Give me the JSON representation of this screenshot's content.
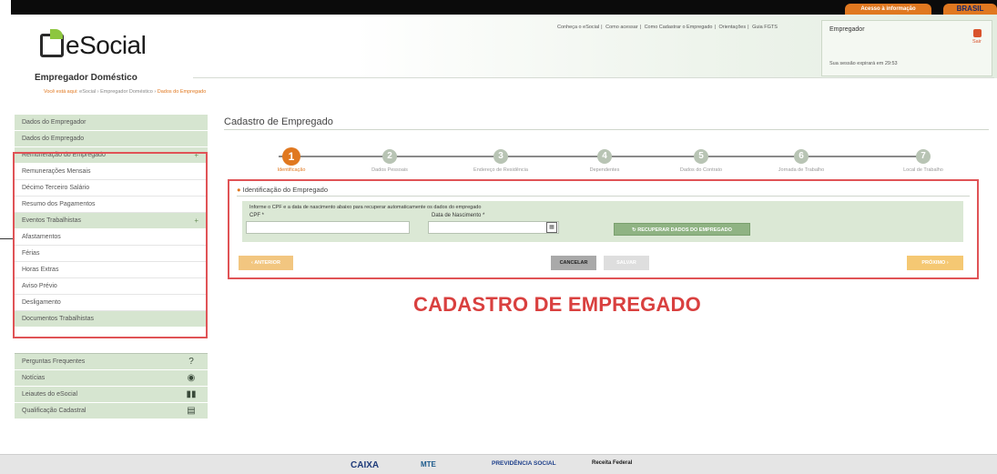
{
  "topbar": {
    "acesso_label": "Acesso à informação",
    "brasil_label": "BRASIL"
  },
  "header": {
    "logo_text": "eSocial",
    "links": [
      "Conheça o eSocial",
      "Como acessar",
      "Como Cadastrar o Empregado",
      "Orientações",
      "Guia FGTS"
    ],
    "user_label": "Empregador",
    "session_text": "Sua sessão expirará em 29:53",
    "exit_label": "Sair"
  },
  "page": {
    "section_title": "Empregador Doméstico",
    "breadcrumb_prefix": "Você está aqui:",
    "breadcrumb_path": "eSocial › Empregador Doméstico ›",
    "breadcrumb_current": "Dados do Empregado"
  },
  "sidebar": {
    "items": [
      {
        "label": "Dados do Empregador",
        "style": "g",
        "plus": ""
      },
      {
        "label": "Dados do Empregado",
        "style": "g",
        "plus": ""
      },
      {
        "label": "Remuneração do Empregado",
        "style": "g",
        "plus": "+"
      },
      {
        "label": "Remunerações Mensais",
        "style": "w",
        "plus": ""
      },
      {
        "label": "Décimo Terceiro Salário",
        "style": "w",
        "plus": ""
      },
      {
        "label": "Resumo dos Pagamentos",
        "style": "w",
        "plus": ""
      },
      {
        "label": "Eventos Trabalhistas",
        "style": "g",
        "plus": "+"
      },
      {
        "label": "Afastamentos",
        "style": "w",
        "plus": ""
      },
      {
        "label": "Férias",
        "style": "w",
        "plus": ""
      },
      {
        "label": "Horas Extras",
        "style": "w",
        "plus": ""
      },
      {
        "label": "Aviso Prévio",
        "style": "w",
        "plus": ""
      },
      {
        "label": "Desligamento",
        "style": "w",
        "plus": ""
      },
      {
        "label": "Documentos Trabalhistas",
        "style": "g",
        "plus": ""
      }
    ],
    "help": [
      {
        "label": "Perguntas Frequentes",
        "icon": "question-icon",
        "glyph": "?"
      },
      {
        "label": "Notícias",
        "icon": "globe-icon",
        "glyph": "◉"
      },
      {
        "label": "Leiautes do eSocial",
        "icon": "book-icon",
        "glyph": "▮▮"
      },
      {
        "label": "Qualificação Cadastral",
        "icon": "form-icon",
        "glyph": "▤"
      }
    ]
  },
  "main": {
    "title": "Cadastro de Empregado",
    "steps": [
      {
        "num": "1",
        "label": "Identificação"
      },
      {
        "num": "2",
        "label": "Dados Pessoais"
      },
      {
        "num": "3",
        "label": "Endereço de Residência"
      },
      {
        "num": "4",
        "label": "Dependentes"
      },
      {
        "num": "5",
        "label": "Dados do Contrato"
      },
      {
        "num": "6",
        "label": "Jornada de Trabalho"
      },
      {
        "num": "7",
        "label": "Local de Trabalho"
      }
    ],
    "active_step": 1,
    "form": {
      "header": "Identificação do Empregado",
      "info": "Informe o CPF e a data de nascimento abaixo para recuperar automaticamente os dados do empregado",
      "cpf_label": "CPF *",
      "cpf_value": "",
      "birth_label": "Data de Nascimento *",
      "birth_value": "",
      "recover_button": "RECUPERAR DADOS DO EMPREGADO"
    },
    "buttons": {
      "back": "‹ ANTERIOR",
      "cancel": "CANCELAR",
      "save": "SALVAR",
      "next": "PRÓXIMO ›"
    }
  },
  "caption": "CADASTRO DE EMPREGADO",
  "footer": {
    "logos": [
      "CAIXA",
      "MTE",
      "PREVIDÊNCIA SOCIAL",
      "Receita Federal"
    ]
  }
}
